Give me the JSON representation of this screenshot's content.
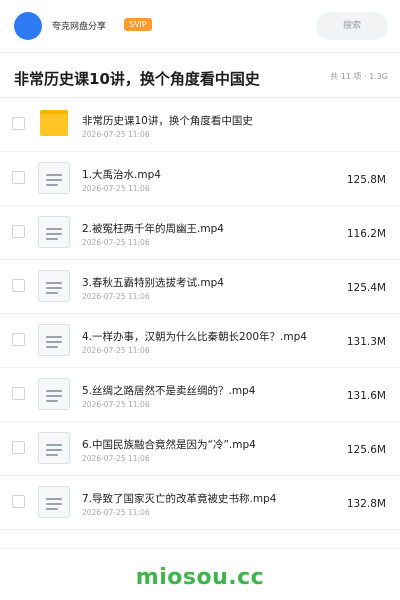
{
  "topbar": {
    "username": "夸克网盘分享",
    "badge": "SVIP",
    "search_placeholder": "搜索"
  },
  "header": {
    "title": "非常历史课10讲，换个角度看中国史",
    "summary": "共 11 项 · 1.3G"
  },
  "files": [
    {
      "icon": "folder-icon",
      "name": "非常历史课10讲，换个角度看中国史",
      "date": "2026-07-25 11:06",
      "size": ""
    },
    {
      "icon": "document-icon",
      "name": "1.大禹治水.mp4",
      "date": "2026-07-25 11:06",
      "size": "125.8M"
    },
    {
      "icon": "document-icon",
      "name": "2.被冤枉两千年的周幽王.mp4",
      "date": "2026-07-25 11:06",
      "size": "116.2M"
    },
    {
      "icon": "document-icon",
      "name": "3.春秋五霸特别选拔考试.mp4",
      "date": "2026-07-25 11:06",
      "size": "125.4M"
    },
    {
      "icon": "document-icon",
      "name": "4.一样办事，汉朝为什么比秦朝长200年？.mp4",
      "date": "2026-07-25 11:06",
      "size": "131.3M"
    },
    {
      "icon": "document-icon",
      "name": "5.丝绸之路居然不是卖丝绸的？.mp4",
      "date": "2026-07-25 11:06",
      "size": "131.6M"
    },
    {
      "icon": "document-icon",
      "name": "6.中国民族融合竟然是因为“冷”.mp4",
      "date": "2026-07-25 11:06",
      "size": "125.6M"
    },
    {
      "icon": "document-icon",
      "name": "7.导致了国家灭亡的改革竟被史书称.mp4",
      "date": "2026-07-25 11:06",
      "size": "132.8M"
    }
  ],
  "watermark": "miosou.cc",
  "colors": {
    "avatar": "#2f7bf5",
    "svip_badge": "#ff9a2e",
    "folder": "#ffc623",
    "watermark": "#3db54a"
  }
}
